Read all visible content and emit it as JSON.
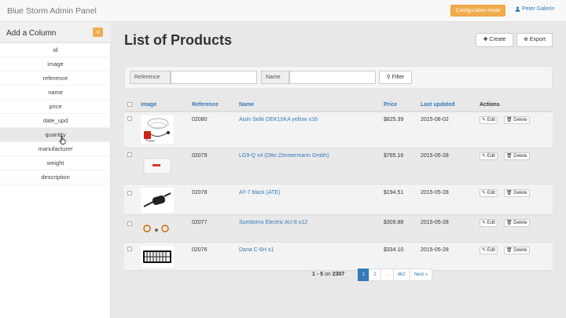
{
  "navbar": {
    "brand": "Blue Storm Admin Panel",
    "config_button": "Configuration mode",
    "user": "Peter Galerin"
  },
  "sidebar": {
    "title": "Add a Column",
    "collapse_glyph": "«",
    "columns": [
      "id",
      "image",
      "reference",
      "name",
      "price",
      "date_upd",
      "quantity",
      "manufacturer",
      "weight",
      "description"
    ],
    "hovered_column": "quantity"
  },
  "main": {
    "title": "List of Products",
    "create_label": "Create",
    "export_label": "Export"
  },
  "filters": {
    "reference_label": "Reference",
    "reference_value": "",
    "name_label": "Name",
    "name_value": "",
    "filter_button": "Filter"
  },
  "table": {
    "headers": {
      "image": "Image",
      "reference": "Reference",
      "name": "Name",
      "price": "Price",
      "last_updated": "Last updated",
      "actions": "Actions"
    },
    "edit_label": "Edit",
    "delete_label": "Delete",
    "rows": [
      {
        "reference": "02080",
        "name": "Aisin Seiki DEK10KA yellow x16",
        "price": "$825.39",
        "updated": "2015-08-02",
        "image": "charger-cables"
      },
      {
        "reference": "02079",
        "name": "LG9-Q x4 (Otto Zimmermann Gmbh)",
        "price": "$765.16",
        "updated": "2015-05-28",
        "image": "white-box"
      },
      {
        "reference": "02078",
        "name": "AY-7 black (ATE)",
        "price": "$194.51",
        "updated": "2015-05-28",
        "image": "exhaust-muffler"
      },
      {
        "reference": "02077",
        "name": "Sumitomo Electric AU-8 x12",
        "price": "$309.88",
        "updated": "2015-05-28",
        "image": "orange-rings"
      },
      {
        "reference": "02076",
        "name": "Dana C-6H x1",
        "price": "$334.10",
        "updated": "2015-05-28",
        "image": "air-filter"
      }
    ]
  },
  "pagination": {
    "range": "1 - 5",
    "on_label": "on",
    "total": "2307",
    "pages": [
      "1",
      "2",
      "...",
      "462",
      "Next »"
    ],
    "active_page": "1"
  },
  "colors": {
    "accent": "#f0ad4e",
    "link": "#337ab7",
    "active_page": "#337ab7"
  }
}
